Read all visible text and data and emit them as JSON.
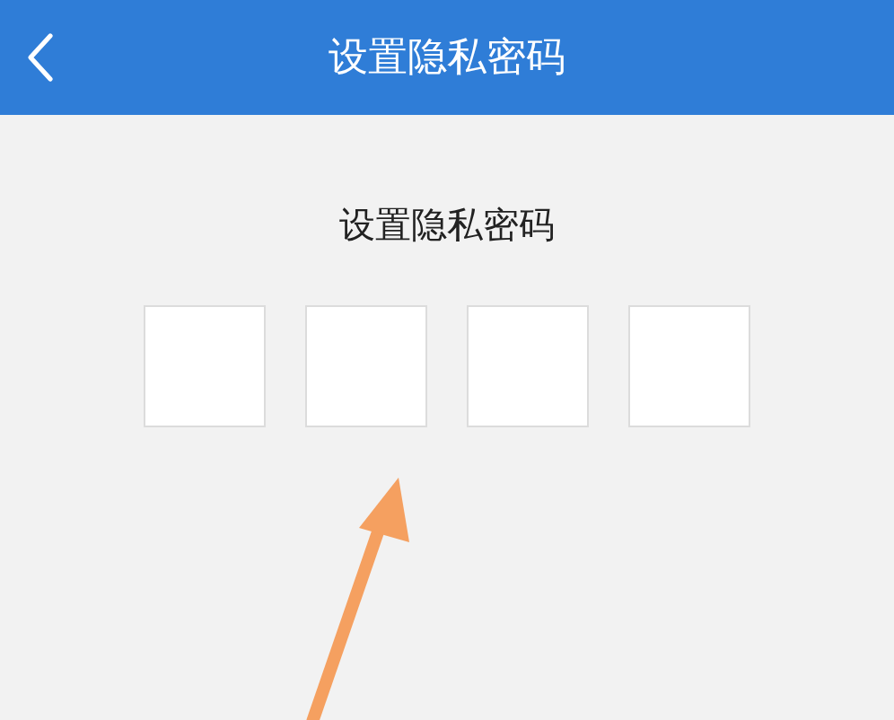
{
  "header": {
    "title": "设置隐私密码"
  },
  "prompt": "设置隐私密码",
  "pin_boxes": [
    {
      "filled": false
    },
    {
      "filled": false
    },
    {
      "filled": false
    },
    {
      "filled": false
    }
  ]
}
